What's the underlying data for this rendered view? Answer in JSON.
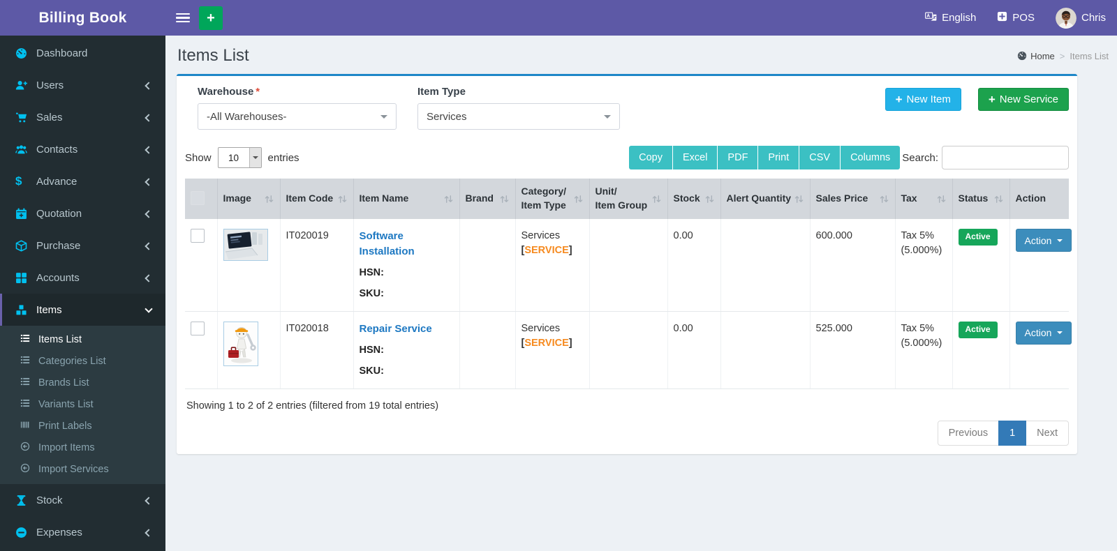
{
  "topbar": {
    "brand": "Billing Book",
    "language_label": "English",
    "pos_label": "POS",
    "user_name": "Chris"
  },
  "icons": {
    "plus": "+",
    "dollar": "$"
  },
  "page": {
    "title": "Items List",
    "breadcrumb_home": "Home",
    "breadcrumb_sep": ">",
    "breadcrumb_current": "Items List"
  },
  "sidebar": {
    "items": [
      {
        "label": "Dashboard"
      },
      {
        "label": "Users"
      },
      {
        "label": "Sales"
      },
      {
        "label": "Contacts"
      },
      {
        "label": "Advance"
      },
      {
        "label": "Quotation"
      },
      {
        "label": "Purchase"
      },
      {
        "label": "Accounts"
      },
      {
        "label": "Items"
      },
      {
        "label": "Stock"
      },
      {
        "label": "Expenses"
      }
    ],
    "items_children": [
      {
        "label": "Items List"
      },
      {
        "label": "Categories List"
      },
      {
        "label": "Brands List"
      },
      {
        "label": "Variants List"
      },
      {
        "label": "Print Labels"
      },
      {
        "label": "Import Items"
      },
      {
        "label": "Import Services"
      }
    ]
  },
  "filters": {
    "warehouse_label": "Warehouse",
    "warehouse_required": "*",
    "warehouse_value": "-All Warehouses-",
    "item_type_label": "Item Type",
    "item_type_value": "Services"
  },
  "actions": {
    "new_item": "New Item",
    "new_service": "New Service"
  },
  "table_controls": {
    "show_label": "Show",
    "page_length": "10",
    "entries_label": "entries",
    "export_buttons": [
      "Copy",
      "Excel",
      "PDF",
      "Print",
      "CSV",
      "Columns"
    ],
    "search_label": "Search:"
  },
  "table": {
    "headers": [
      {
        "l1": "Image"
      },
      {
        "l1": "Item Code"
      },
      {
        "l1": "Item Name"
      },
      {
        "l1": "Brand"
      },
      {
        "l1": "Category/",
        "l2": "Item Type"
      },
      {
        "l1": "Unit/",
        "l2": "Item Group"
      },
      {
        "l1": "Stock"
      },
      {
        "l1": "Alert Quantity"
      },
      {
        "l1": "Sales Price"
      },
      {
        "l1": "Tax"
      },
      {
        "l1": "Status"
      },
      {
        "l1": "Action"
      }
    ],
    "rows": [
      {
        "item_code": "IT020019",
        "item_name": "Software Installation",
        "hsn_label": "HSN:",
        "sku_label": "SKU:",
        "brand": "",
        "category": "Services",
        "type_open": "[",
        "item_type": "SERVICE",
        "type_close": "]",
        "unit_group": "",
        "stock": "0.00",
        "alert_quantity": "",
        "sales_price": "600.000",
        "tax_line1": "Tax 5%",
        "tax_line2": "(5.000%)",
        "status": "Active",
        "action_label": "Action"
      },
      {
        "item_code": "IT020018",
        "item_name": "Repair Service",
        "hsn_label": "HSN:",
        "sku_label": "SKU:",
        "brand": "",
        "category": "Services",
        "type_open": "[",
        "item_type": "SERVICE",
        "type_close": "]",
        "unit_group": "",
        "stock": "0.00",
        "alert_quantity": "",
        "sales_price": "525.000",
        "tax_line1": "Tax 5%",
        "tax_line2": "(5.000%)",
        "status": "Active",
        "action_label": "Action"
      }
    ],
    "summary": "Showing 1 to 2 of 2 entries (filtered from 19 total entries)"
  },
  "pagination": {
    "previous": "Previous",
    "page": "1",
    "next": "Next"
  },
  "colors": {
    "topbar_purple": "#5d59a6",
    "sidebar_dark": "#222d32",
    "icon_accent": "#00c0ef",
    "primary_blue": "#3c8dbc",
    "success_green": "#16a65a",
    "export_teal": "#3bc0c3",
    "new_item_aqua": "#23b2e8",
    "service_orange": "#f68a1f"
  }
}
